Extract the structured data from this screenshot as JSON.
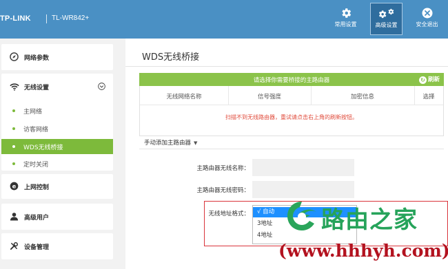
{
  "header": {
    "brand": "TP-LINK",
    "model": "TL-WR842+",
    "buttons": [
      {
        "label": "常用设置",
        "icon": "gear-icon"
      },
      {
        "label": "高级设置",
        "icon": "gears-icon",
        "active": true
      },
      {
        "label": "安全退出",
        "icon": "exit-icon"
      }
    ]
  },
  "sidebar": {
    "network": "网络参数",
    "wireless": "无线设置",
    "wireless_sub": [
      "主网络",
      "访客网络",
      "WDS无线桥接",
      "定时关闭"
    ],
    "active_sub": "WDS无线桥接",
    "internet_control": "上网控制",
    "advanced_user": "高级用户",
    "device_mgmt": "设备管理"
  },
  "main": {
    "title": "WDS无线桥接",
    "scan_msg": "请选择你需要桥接的主路由器",
    "refresh": "刷新",
    "columns": [
      "无线网络名称",
      "信号强度",
      "加密信息",
      "选择"
    ],
    "empty_msg": "扫描不到无线路由器，重试请点击右上角的刷新按钮。",
    "manual_add": "手动添加主路由器",
    "fields": {
      "ssid_label": "主路由器无线名称：",
      "pwd_label": "主路由器无线密码：",
      "addr_label": "无线地址格式："
    },
    "dropdown": {
      "options": [
        "√ 自动",
        "3地址",
        "4地址"
      ],
      "selected_index": 0
    }
  },
  "watermark": {
    "name": "路由之家",
    "url": "(www.hhhyh.com)"
  },
  "colors": {
    "header": "#4a90c4",
    "header_active": "#2f6d9e",
    "accent_green": "#7dba3b",
    "scan_bar": "#8bc34a",
    "error_red": "#e04a3a",
    "highlight_box": "#d9333a"
  }
}
